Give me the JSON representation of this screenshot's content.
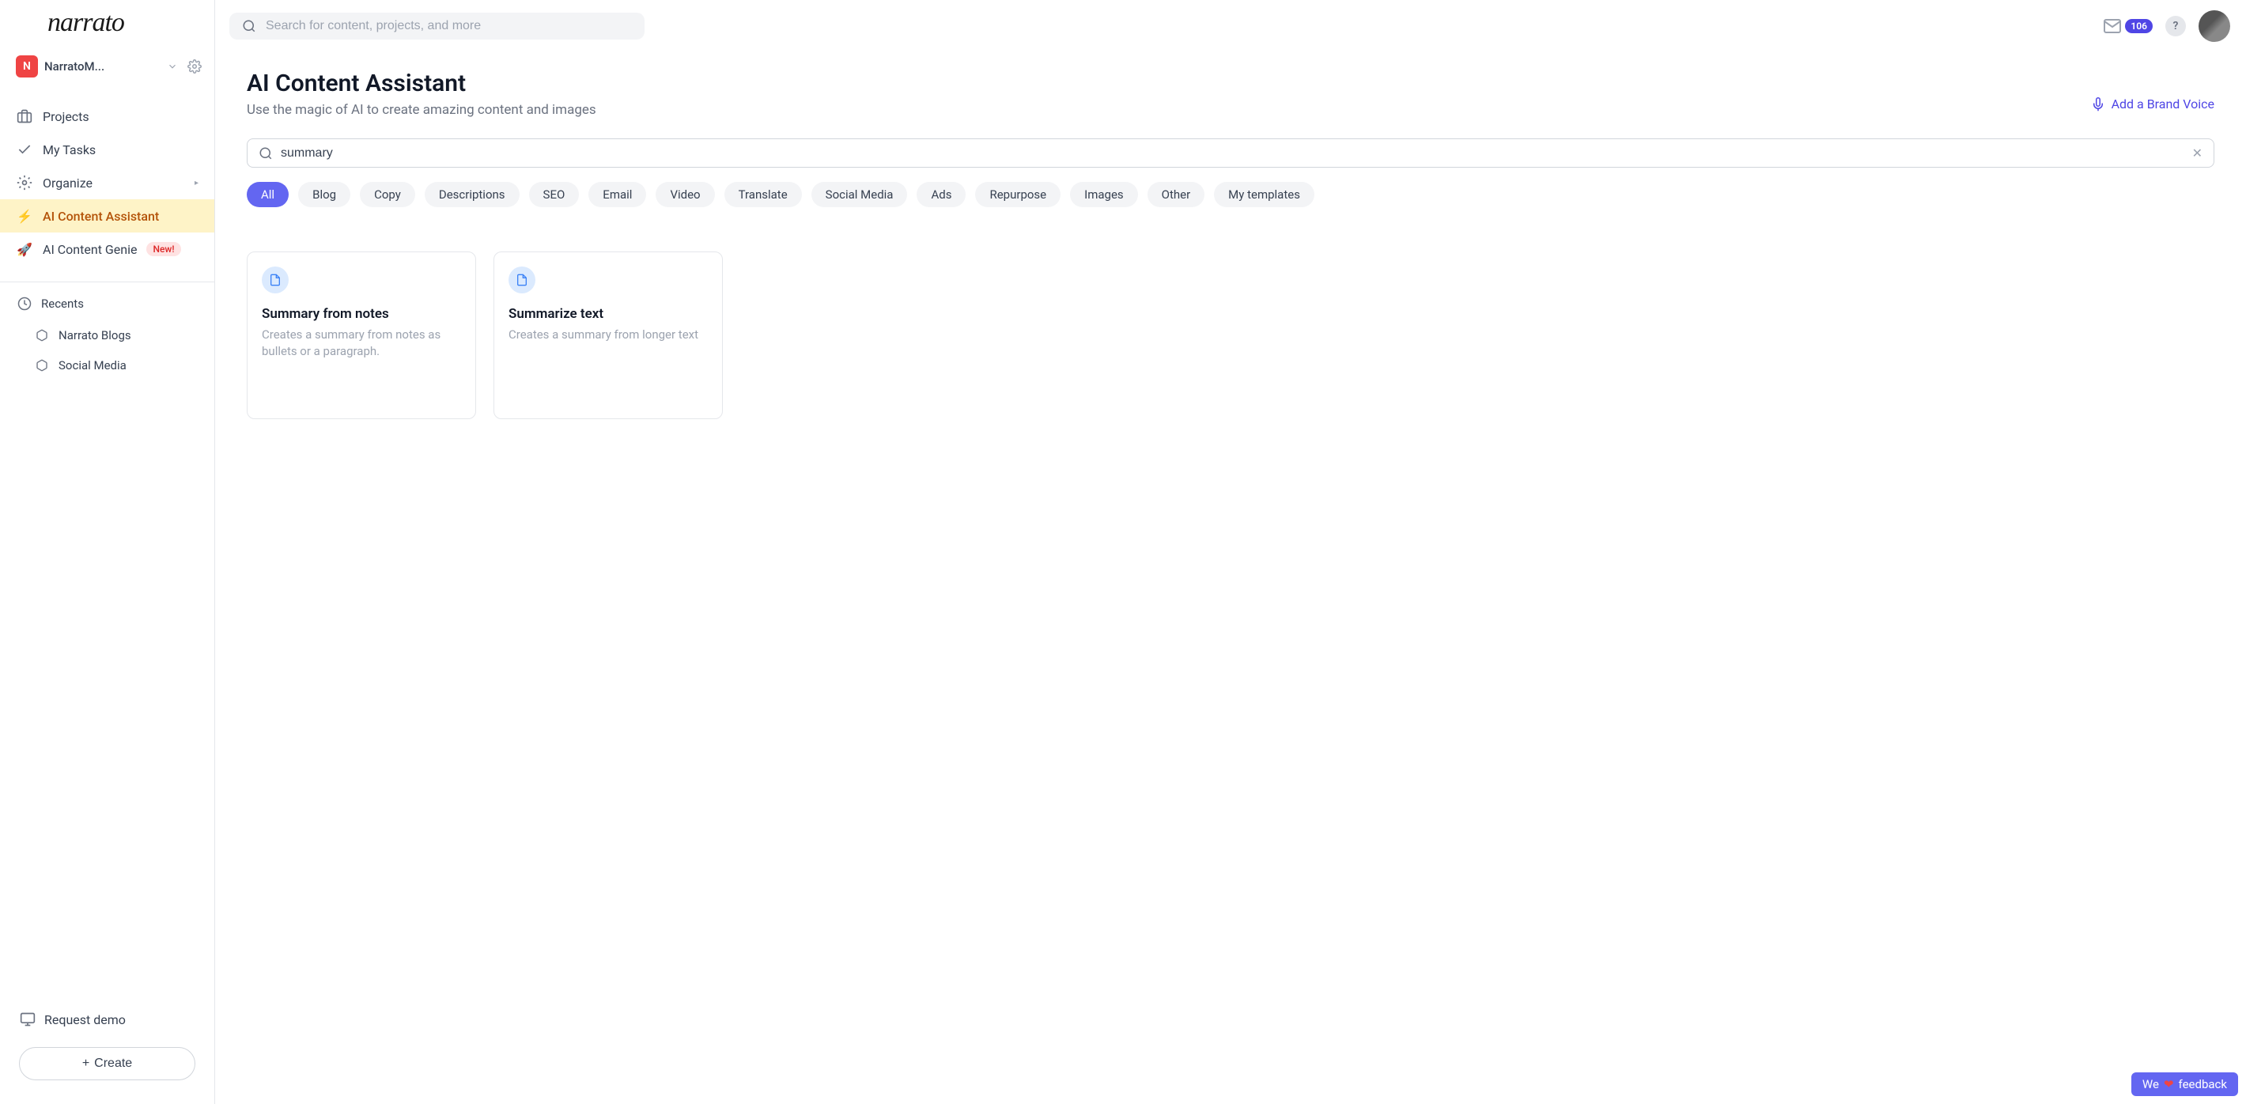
{
  "logo_text": "narrato",
  "workspace": {
    "initial": "N",
    "name": "NarratoM..."
  },
  "sidebar": {
    "projects": "Projects",
    "my_tasks": "My Tasks",
    "organize": "Organize",
    "ai_assistant": "AI Content Assistant",
    "ai_genie": "AI Content Genie",
    "new_badge": "New!",
    "recents_header": "Recents",
    "recents": [
      "Narrato Blogs",
      "Social Media"
    ],
    "request_demo": "Request demo",
    "create": "Create"
  },
  "topbar": {
    "search_placeholder": "Search for content, projects, and more",
    "notification_count": "106"
  },
  "page": {
    "title": "AI Content Assistant",
    "subtitle": "Use the magic of AI to create amazing content and images",
    "brand_voice": "Add a Brand Voice",
    "filter_value": "summary"
  },
  "chips": [
    "All",
    "Blog",
    "Copy",
    "Descriptions",
    "SEO",
    "Email",
    "Video",
    "Translate",
    "Social Media",
    "Ads",
    "Repurpose",
    "Images",
    "Other",
    "My templates"
  ],
  "active_chip_index": 0,
  "cards": [
    {
      "title": "Summary from notes",
      "desc": "Creates a summary from notes as bullets or a paragraph."
    },
    {
      "title": "Summarize text",
      "desc": "Creates a summary from longer text"
    }
  ],
  "feedback": {
    "prefix": "We",
    "suffix": "feedback"
  }
}
